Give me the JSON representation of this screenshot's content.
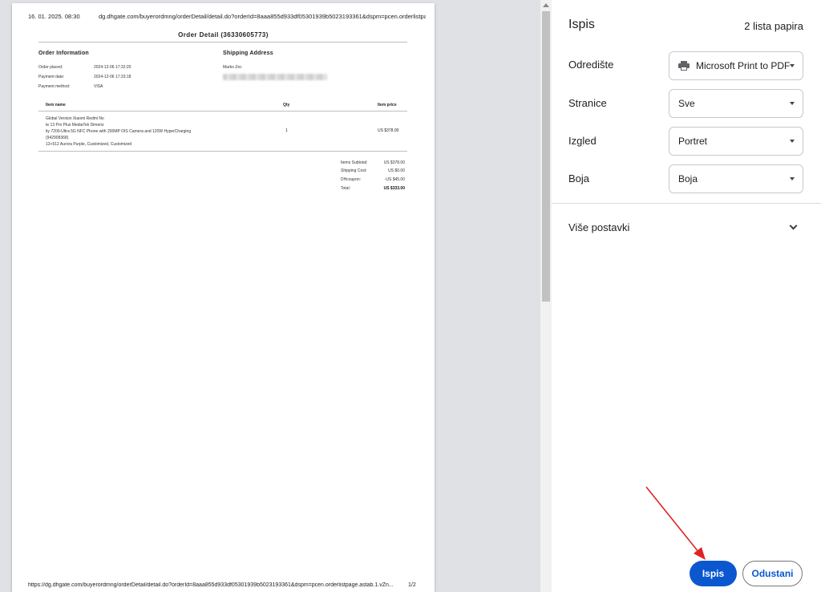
{
  "preview": {
    "header_date": "16. 01. 2025. 08:30",
    "header_url": "dg.dhgate.com/buyerordmng/orderDetail/detail.do?orderId=8aaa855d933df05301939b5023193361&dspm=pcen.orderlistpa...",
    "title": "Order Detail (36330605773)",
    "order_info": {
      "heading": "Order Information",
      "rows": [
        {
          "key": "Order placed:",
          "value": "2024-12-06 17:32:20"
        },
        {
          "key": "Payment date:",
          "value": "2024-12-06 17:33:18"
        },
        {
          "key": "Payment method:",
          "value": "VISA"
        }
      ]
    },
    "shipping": {
      "heading": "Shipping Address",
      "name": "Marko Zec"
    },
    "table": {
      "headers": [
        "Item name",
        "Qty",
        "Item price"
      ],
      "item_lines": [
        "Global Version Xiaomi Redmi No",
        "te 13 Pro Plus MediaTek Dimens",
        "ity 7200-Ultra 5G NFC Phone with 200MP OIS Camera and 120W HyperCharging",
        "(942908368)",
        "12+512 Aurora Purple, Customized, Customized"
      ],
      "qty": "1",
      "price": "US $378.00"
    },
    "summary": [
      {
        "label": "Items Subtotal:",
        "value": "US $378.00"
      },
      {
        "label": "Shipping Cost:",
        "value": "US $0.00"
      },
      {
        "label": "DHcoupon:",
        "value": "-US $45.00"
      },
      {
        "label": "Total:",
        "value": "US $333.00"
      }
    ],
    "footer_url": "https://dg.dhgate.com/buyerordmng/orderDetail/detail.do?orderId=8aaa855d933df05301939b5023193361&dspm=pcen.orderlistpage.astab.1.vZn...",
    "footer_page": "1/2"
  },
  "panel": {
    "title": "Ispis",
    "sheets": "2 lista papira",
    "destination": {
      "label": "Odredište",
      "value": "Microsoft Print to PDF",
      "icon": "printer-icon"
    },
    "pages": {
      "label": "Stranice",
      "value": "Sve"
    },
    "layout": {
      "label": "Izgled",
      "value": "Portret"
    },
    "color": {
      "label": "Boja",
      "value": "Boja"
    },
    "more_settings": "Više postavki",
    "print_button": "Ispis",
    "cancel_button": "Odustani",
    "accent_color": "#0b57d0"
  },
  "annotation": {
    "type": "red-arrow",
    "target": "print-button",
    "color": "#e02424"
  }
}
